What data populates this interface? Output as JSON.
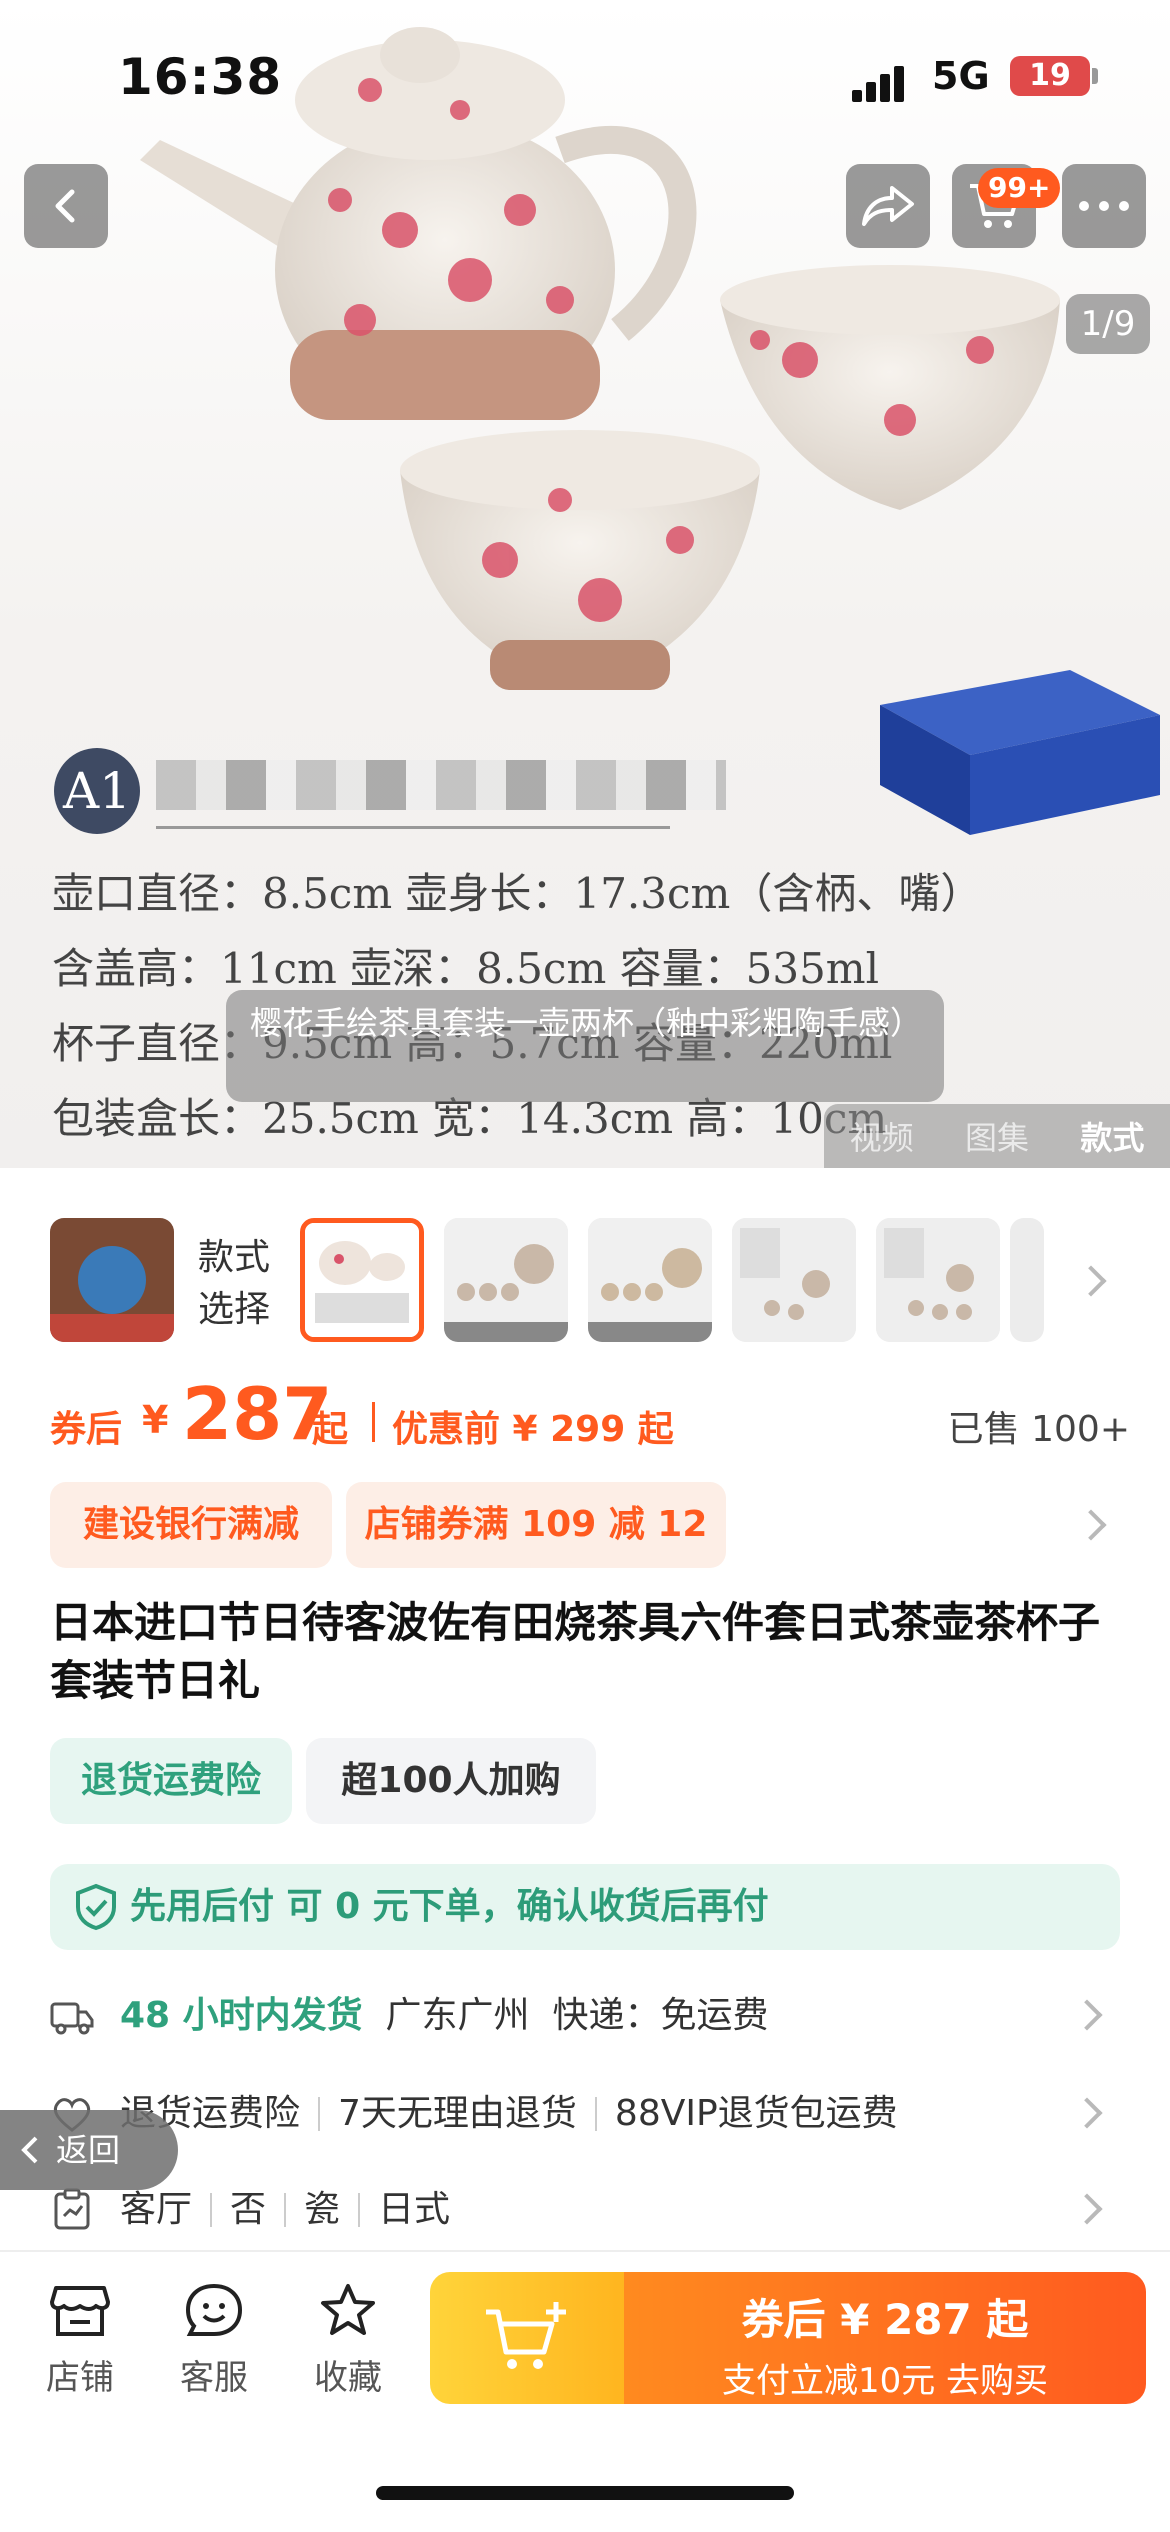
{
  "status_bar": {
    "time": "16:38",
    "network": "5G",
    "battery": "19"
  },
  "header": {
    "cart_badge": "99+",
    "page_indicator": "1/9"
  },
  "image": {
    "badge": "A1",
    "spec_lines": [
      "壶口直径：8.5cm   壶身长：17.3cm（含柄、嘴）",
      "含盖高：11cm   壶深：8.5cm   容量：535ml",
      "杯子直径：9.5cm   高：5.7cm   容量：220ml",
      "包装盒长：25.5cm   宽：14.3cm   高：10cm"
    ],
    "caption": "樱花手绘茶具套装一壶两杯（釉中彩粗陶手感）",
    "media_tabs": [
      "视频",
      "图集",
      "款式"
    ]
  },
  "style_selector": {
    "label": "款式选择"
  },
  "price": {
    "prefix": "券后",
    "currency": "¥",
    "value": "287",
    "suffix": "起",
    "before_label": "优惠前 ¥ 299 起",
    "sold": "已售 100+"
  },
  "coupons": [
    "建设银行满减",
    "店铺券满 109 减 12"
  ],
  "product_title": "日本进口节日待客波佐有田烧茶具六件套日式茶壶茶杯子套装节日礼",
  "tags": [
    "退货运费险",
    "超100人加购"
  ],
  "pay_later": "先用后付 可 0 元下单，确认收货后再付",
  "shipping": {
    "time": "48 小时内发货",
    "location": "广东广州",
    "courier": "快递：免运费"
  },
  "services": [
    "退货运费险",
    "7天无理由退货",
    "88VIP退货包运费"
  ],
  "attributes": [
    "客厅",
    "否",
    "瓷",
    "日式"
  ],
  "back_label": "返回",
  "bottom_bar": {
    "shop": "店铺",
    "service": "客服",
    "favorite": "收藏",
    "buy_main": "券后 ¥ 287 起",
    "buy_sub": "支付立减10元  去购买"
  },
  "colors": {
    "accent": "#ff5a1f",
    "green": "#2fa17d",
    "cart_yellow": "#ffc52b"
  }
}
